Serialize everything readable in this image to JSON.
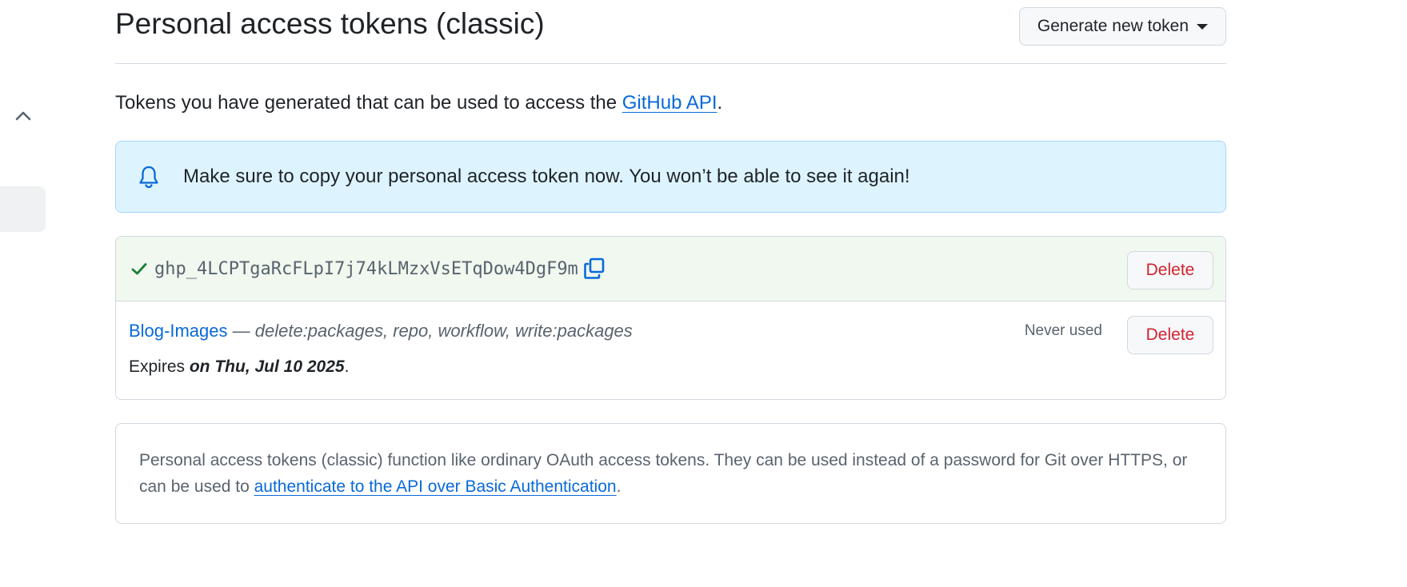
{
  "page": {
    "title": "Personal access tokens (classic)",
    "generate_button": "Generate new token"
  },
  "intro": {
    "text": "Tokens you have generated that can be used to access the ",
    "link": "GitHub API",
    "period": "."
  },
  "flash": {
    "icon": "bell-icon",
    "message": "Make sure to copy your personal access token now. You won’t be able to see it again!"
  },
  "new_token": {
    "icon": "check-icon",
    "value": "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",
    "delete_label": "Delete"
  },
  "token": {
    "name": "Blog-Images",
    "separator": " — ",
    "scopes": "delete:packages, repo, workflow, write:packages",
    "last_used": "Never used",
    "expires_prefix": "Expires ",
    "expires_date": "on Thu, Jul 10 2025",
    "expires_suffix": ".",
    "delete_label": "Delete"
  },
  "info": {
    "text": "Personal access tokens (classic) function like ordinary OAuth access tokens. They can be used instead of a password for Git over HTTPS, or can be used to ",
    "link": "authenticate to the API over Basic Authentication",
    "period": "."
  },
  "colors": {
    "accent": "#0969da",
    "danger": "#d1242f",
    "success": "#1a7f37",
    "flash_bg": "#ddf4ff",
    "new_token_bg": "#f0f8ef"
  }
}
